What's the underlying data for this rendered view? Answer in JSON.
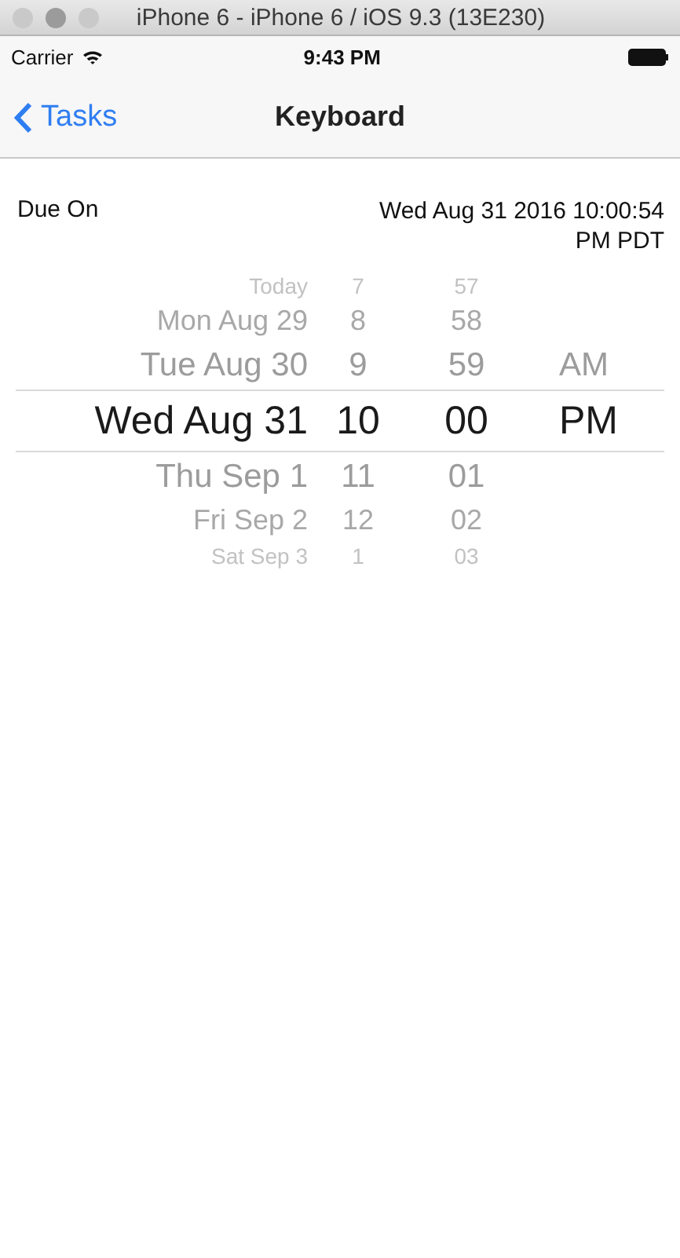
{
  "window": {
    "title": "iPhone 6 - iPhone 6 / iOS 9.3 (13E230)"
  },
  "status_bar": {
    "carrier": "Carrier",
    "time": "9:43 PM"
  },
  "nav_bar": {
    "back": "Tasks",
    "title": "Keyboard"
  },
  "due_on": {
    "label": "Due On",
    "value": "Wed Aug 31 2016 10:00:54 PM PDT"
  },
  "picker": {
    "rows": [
      {
        "date": "Today",
        "hour": "7",
        "minute": "57",
        "selected": false
      },
      {
        "date": "Mon Aug 29",
        "hour": "8",
        "minute": "58",
        "selected": false
      },
      {
        "date": "Tue Aug 30",
        "hour": "9",
        "minute": "59",
        "meridiem": "AM",
        "selected": false
      },
      {
        "date": "Wed Aug 31",
        "hour": "10",
        "minute": "00",
        "meridiem": "PM",
        "selected": true
      },
      {
        "date": "Thu Sep 1",
        "hour": "11",
        "minute": "01",
        "selected": false
      },
      {
        "date": "Fri Sep 2",
        "hour": "12",
        "minute": "02",
        "selected": false
      },
      {
        "date": "Sat Sep 3",
        "hour": "1",
        "minute": "03",
        "selected": false
      }
    ]
  }
}
